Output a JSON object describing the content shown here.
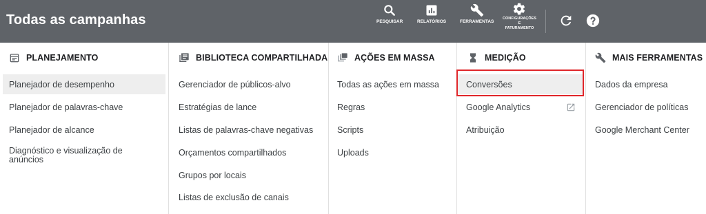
{
  "header": {
    "title": "Todas as campanhas",
    "tools": [
      {
        "label": "PESQUISAR",
        "icon": "search-icon"
      },
      {
        "label": "RELATÓRIOS",
        "icon": "reports-icon"
      },
      {
        "label": "FERRAMENTAS",
        "icon": "wrench-icon"
      },
      {
        "label_lines": [
          "CONFIGURAÇÕES",
          "E",
          "FATURAMENTO"
        ],
        "icon": "gear-icon"
      }
    ],
    "refresh_icon": "refresh-icon",
    "help_icon": "help-icon"
  },
  "columns": [
    {
      "title": "PLANEJAMENTO",
      "icon": "calendar-icon",
      "items": [
        "Planejador de desempenho",
        "Planejador de palavras-chave",
        "Planejador de alcance",
        "Diagnóstico e visualização de anúncios"
      ]
    },
    {
      "title": "BIBLIOTECA COMPARTILHADA",
      "icon": "library-icon",
      "items": [
        "Gerenciador de públicos-alvo",
        "Estratégias de lance",
        "Listas de palavras-chave negativas",
        "Orçamentos compartilhados",
        "Grupos por locais",
        "Listas de exclusão de canais"
      ]
    },
    {
      "title": "AÇÕES EM MASSA",
      "icon": "bulk-actions-icon",
      "items": [
        "Todas as ações em massa",
        "Regras",
        "Scripts",
        "Uploads"
      ]
    },
    {
      "title": "MEDIÇÃO",
      "icon": "hourglass-icon",
      "items": [
        "Conversões",
        "Google Analytics",
        "Atribuição"
      ]
    },
    {
      "title": "MAIS FERRAMENTAS",
      "icon": "wrench-icon",
      "items": [
        "Dados da empresa",
        "Gerenciador de políticas",
        "Google Merchant Center"
      ]
    }
  ],
  "colors": {
    "topbar": "#5f6368",
    "highlight": "#e0262a",
    "selected_bg": "#eeeeee"
  }
}
